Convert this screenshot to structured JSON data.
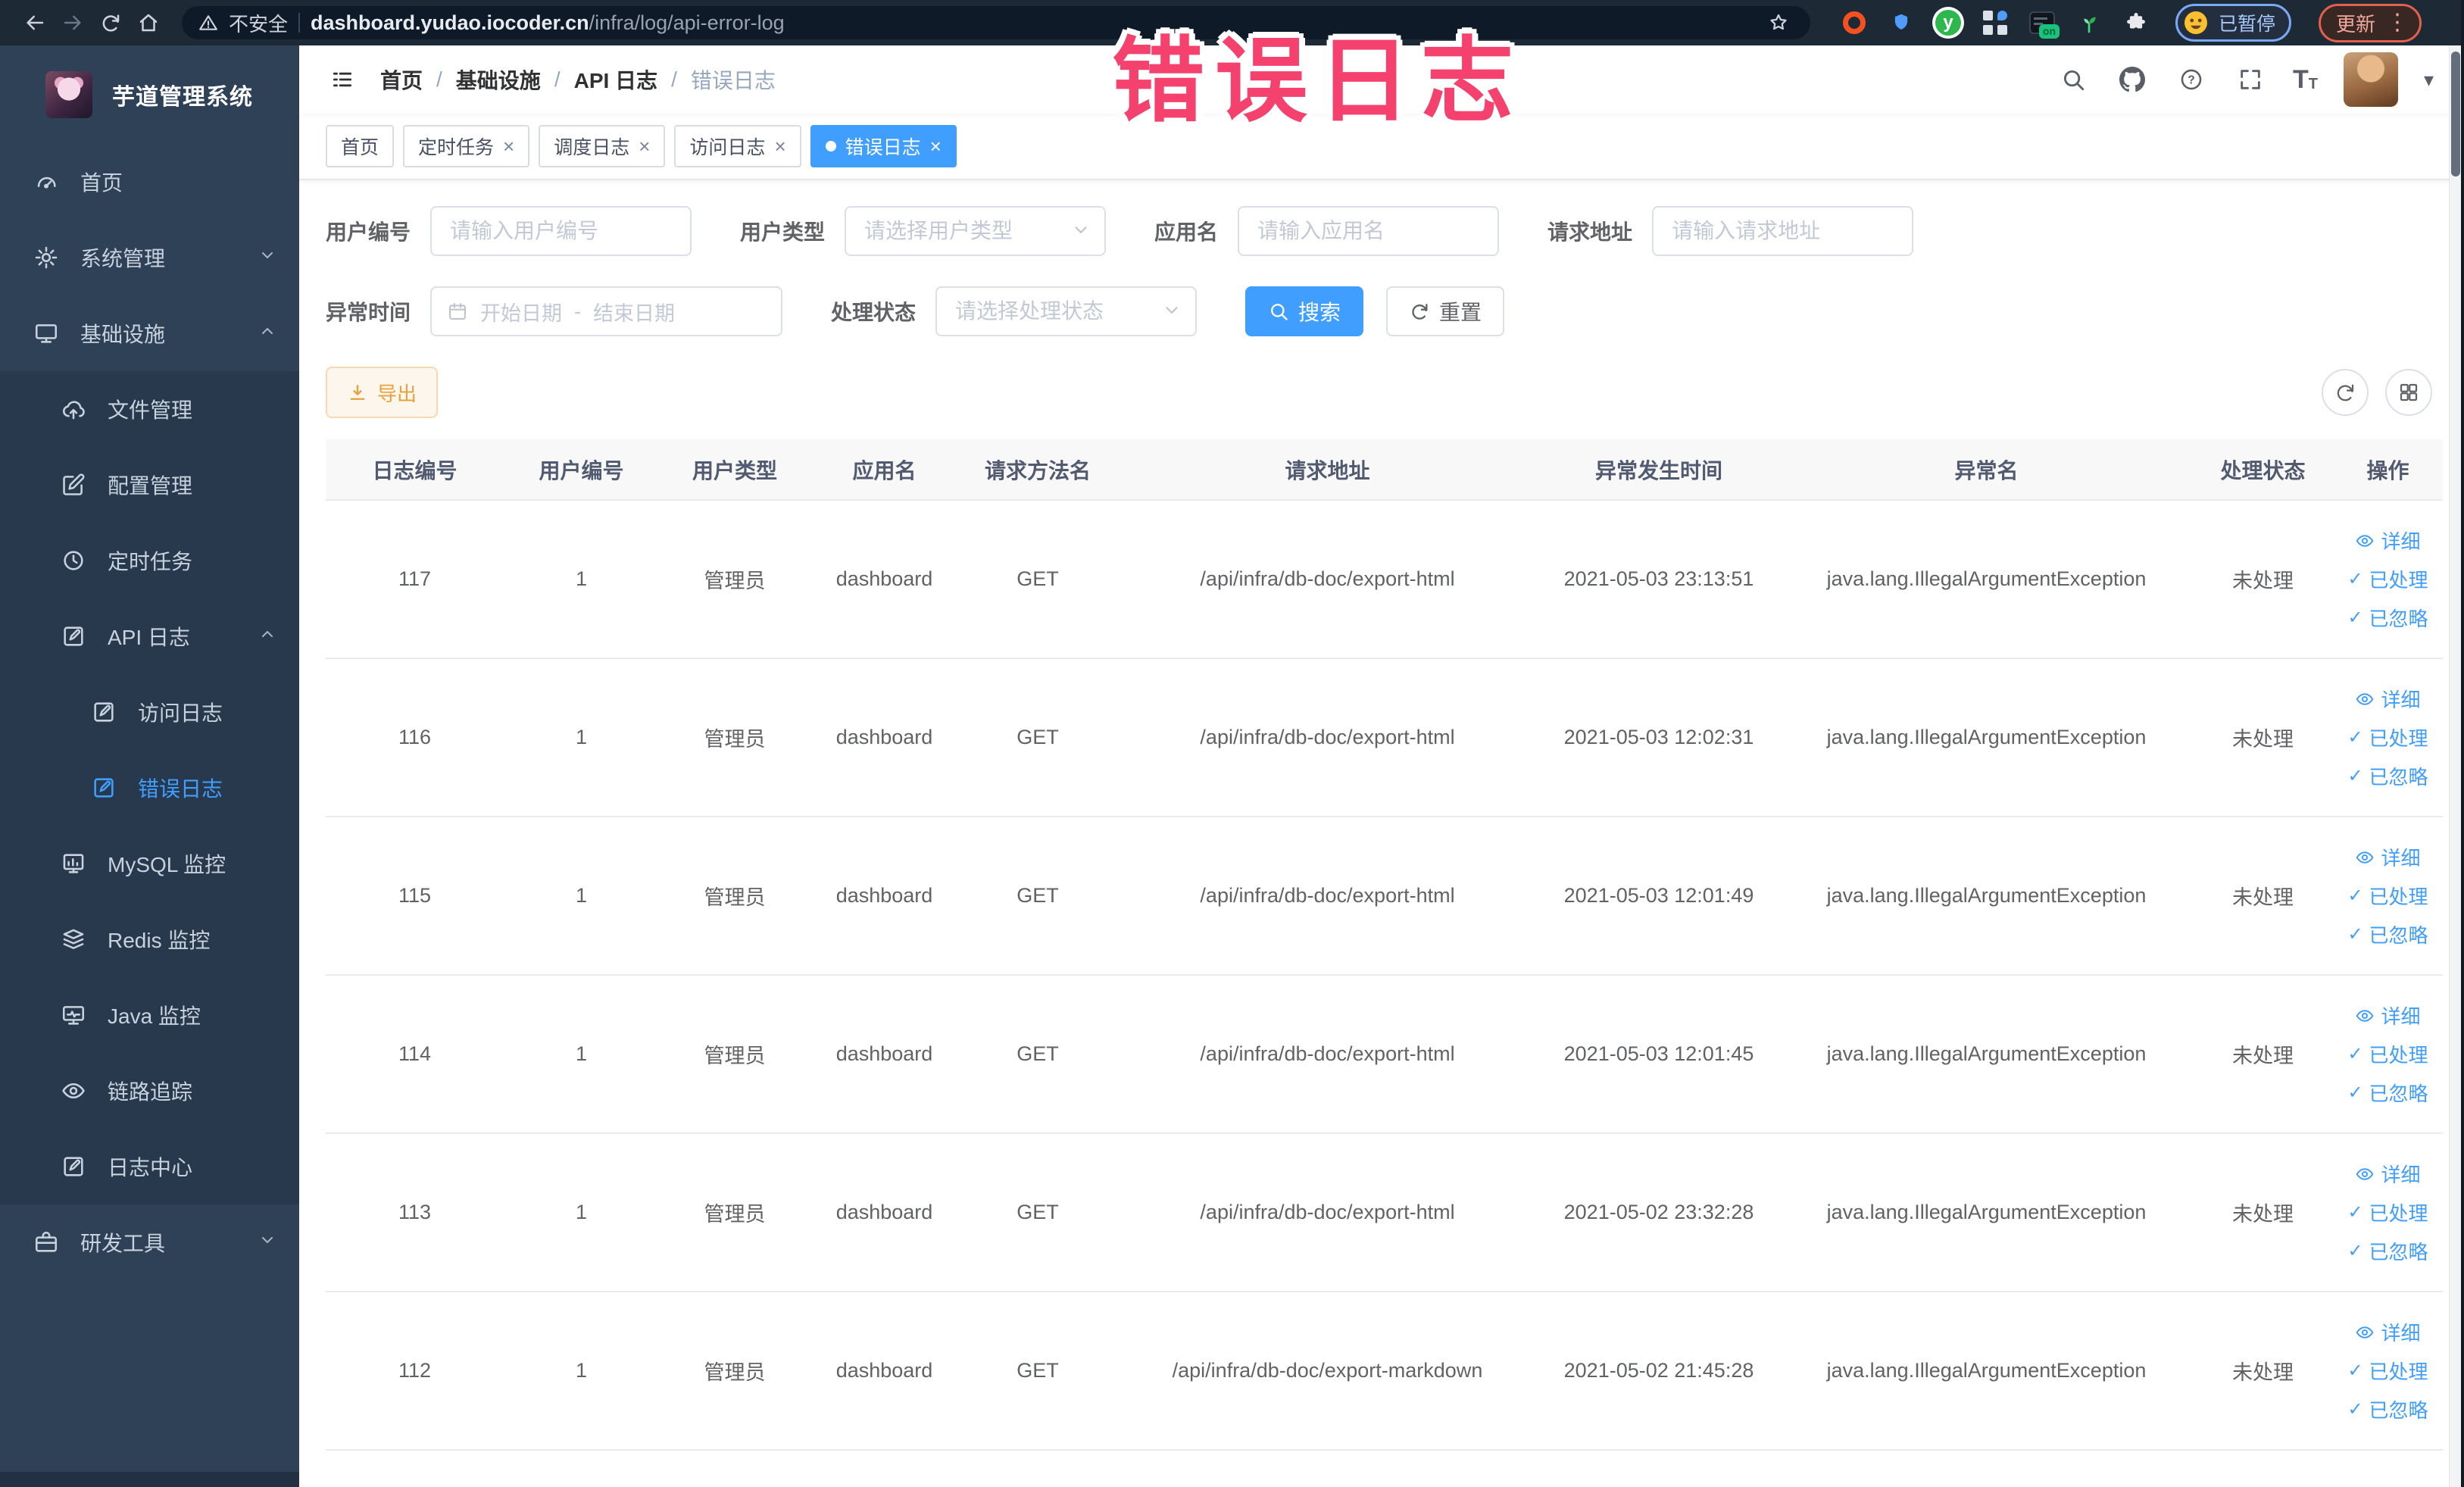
{
  "browser": {
    "security_label": "不安全",
    "url_domain": "dashboard.yudao.iocoder.cn",
    "url_path": "/infra/log/api-error-log",
    "ext_y_glyph": "y",
    "ext_on_badge": "on",
    "profile_status_chip": "已暂停",
    "update_button_label": "更新",
    "kebab_glyph": "⋮"
  },
  "watermark": {
    "text": "错误日志",
    "color": "#f4416d"
  },
  "sidebar": {
    "title": "芋道管理系统",
    "items": [
      {
        "label": "首页"
      },
      {
        "label": "系统管理"
      },
      {
        "label": "基础设施"
      },
      {
        "label": "文件管理"
      },
      {
        "label": "配置管理"
      },
      {
        "label": "定时任务"
      },
      {
        "label": "API 日志"
      },
      {
        "label": "访问日志"
      },
      {
        "label": "错误日志"
      },
      {
        "label": "MySQL 监控"
      },
      {
        "label": "Redis 监控"
      },
      {
        "label": "Java 监控"
      },
      {
        "label": "链路追踪"
      },
      {
        "label": "日志中心"
      },
      {
        "label": "研发工具"
      }
    ]
  },
  "header": {
    "breadcrumb": [
      "首页",
      "基础设施",
      "API 日志",
      "错误日志"
    ],
    "separator": "/"
  },
  "tabs": [
    {
      "label": "首页"
    },
    {
      "label": "定时任务"
    },
    {
      "label": "调度日志"
    },
    {
      "label": "访问日志"
    },
    {
      "label": "错误日志"
    }
  ],
  "filters": {
    "user_id": {
      "label": "用户编号",
      "placeholder": "请输入用户编号"
    },
    "user_type": {
      "label": "用户类型",
      "placeholder": "请选择用户类型"
    },
    "app_name": {
      "label": "应用名",
      "placeholder": "请输入应用名"
    },
    "request_url": {
      "label": "请求地址",
      "placeholder": "请输入请求地址"
    },
    "exception_time": {
      "label": "异常时间",
      "start_placeholder": "开始日期",
      "separator": "-",
      "end_placeholder": "结束日期"
    },
    "process_status": {
      "label": "处理状态",
      "placeholder": "请选择处理状态"
    },
    "search_button": "搜索",
    "reset_button": "重置"
  },
  "toolbar": {
    "export_button": "导出"
  },
  "table": {
    "headers": [
      "日志编号",
      "用户编号",
      "用户类型",
      "应用名",
      "请求方法名",
      "请求地址",
      "异常发生时间",
      "异常名",
      "处理状态",
      "操作"
    ],
    "actions": {
      "detail": "详细",
      "processed": "已处理",
      "ignored": "已忽略"
    },
    "rows": [
      {
        "id": "117",
        "user_id": "1",
        "user_type": "管理员",
        "app_name": "dashboard",
        "method": "GET",
        "url": "/api/infra/db-doc/export-html",
        "time": "2021-05-03 23:13:51",
        "exception": "java.lang.IllegalArgumentException",
        "status": "未处理"
      },
      {
        "id": "116",
        "user_id": "1",
        "user_type": "管理员",
        "app_name": "dashboard",
        "method": "GET",
        "url": "/api/infra/db-doc/export-html",
        "time": "2021-05-03 12:02:31",
        "exception": "java.lang.IllegalArgumentException",
        "status": "未处理"
      },
      {
        "id": "115",
        "user_id": "1",
        "user_type": "管理员",
        "app_name": "dashboard",
        "method": "GET",
        "url": "/api/infra/db-doc/export-html",
        "time": "2021-05-03 12:01:49",
        "exception": "java.lang.IllegalArgumentException",
        "status": "未处理"
      },
      {
        "id": "114",
        "user_id": "1",
        "user_type": "管理员",
        "app_name": "dashboard",
        "method": "GET",
        "url": "/api/infra/db-doc/export-html",
        "time": "2021-05-03 12:01:45",
        "exception": "java.lang.IllegalArgumentException",
        "status": "未处理"
      },
      {
        "id": "113",
        "user_id": "1",
        "user_type": "管理员",
        "app_name": "dashboard",
        "method": "GET",
        "url": "/api/infra/db-doc/export-html",
        "time": "2021-05-02 23:32:28",
        "exception": "java.lang.IllegalArgumentException",
        "status": "未处理"
      },
      {
        "id": "112",
        "user_id": "1",
        "user_type": "管理员",
        "app_name": "dashboard",
        "method": "GET",
        "url": "/api/infra/db-doc/export-markdown",
        "time": "2021-05-02 21:45:28",
        "exception": "java.lang.IllegalArgumentException",
        "status": "未处理"
      }
    ]
  },
  "icons": {
    "close_glyph": "×",
    "check_glyph": "✓",
    "caret_glyph": "▾",
    "question_glyph": "?",
    "font_size_glyph": "T",
    "font_size_glyph_small": "T"
  },
  "colors": {
    "accent": "#409EFF",
    "warning_text": "#e6a23c",
    "warning_bg": "#fdf6ec",
    "sidebar_bg": "#2f4156",
    "submenu_bg": "#28394d",
    "browser_bar_bg": "#1e2936",
    "table_header_bg": "#f8f8f9",
    "watermark_pink": "#f4416d"
  }
}
